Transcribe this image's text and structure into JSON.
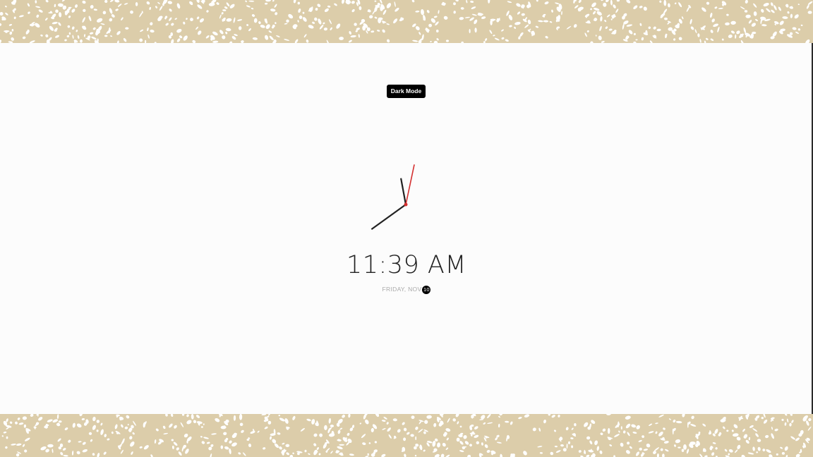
{
  "theme_toggle": {
    "label": "Dark Mode"
  },
  "clock": {
    "time_text": "11:39 AM",
    "hour": 11,
    "minute": 39,
    "second": 2,
    "second_hand_color": "#d32f2f",
    "hand_color": "#222222"
  },
  "date": {
    "weekday_month": "FRIDAY, NOV",
    "day": "10"
  },
  "colors": {
    "border_pattern_bg": "#dccdaa",
    "panel_bg": "#fcfcfc",
    "button_bg": "#000000"
  }
}
